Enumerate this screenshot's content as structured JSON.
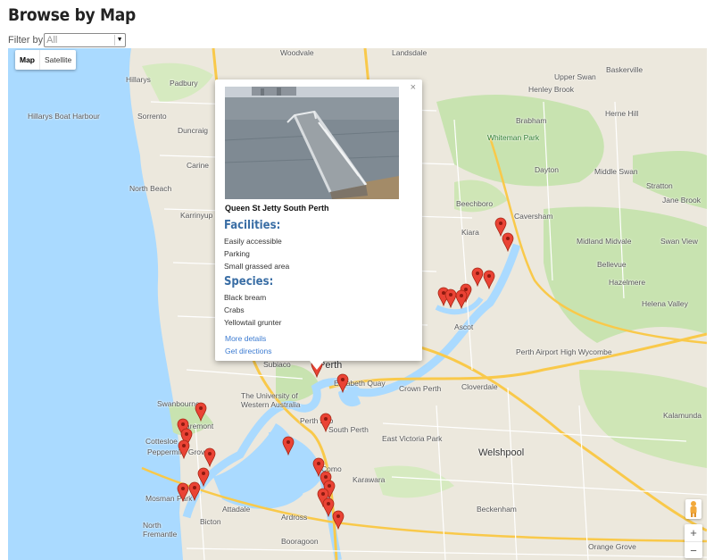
{
  "page": {
    "title": "Browse by Map"
  },
  "filter": {
    "label": "Filter by",
    "value": "All"
  },
  "map": {
    "type_controls": [
      "Map",
      "Satellite"
    ],
    "zoom_in": "+",
    "zoom_out": "−",
    "labels": {
      "hillarys": "Hillarys",
      "padbury": "Padbury",
      "woodvale": "Woodvale",
      "landsdale": "Landsdale",
      "baskerville": "Baskerville",
      "upper_swan": "Upper Swan",
      "henley_brook": "Henley Brook",
      "hillarys_harbour": "Hillarys Boat Harbour",
      "sorrento": "Sorrento",
      "brabham": "Brabham",
      "herne_hill": "Herne Hill",
      "duncraig": "Duncraig",
      "whiteman_park": "Whiteman Park",
      "carine": "Carine",
      "dayton": "Dayton",
      "middle_swan": "Middle Swan",
      "north_beach": "North Beach",
      "stratton": "Stratton",
      "jane_brook": "Jane Brook",
      "karrinyup": "Karrinyup",
      "beechboro": "Beechboro",
      "caversham": "Caversham",
      "midland": "Midland Midvale",
      "swan_view": "Swan View",
      "kiara": "Kiara",
      "bellevue": "Bellevue",
      "hazelmere": "Hazelmere",
      "helena_valley": "Helena Valley",
      "ascot": "Ascot",
      "perth_airport": "Perth Airport",
      "high_wycombe": "High Wycombe",
      "perth": "Perth",
      "elizabeth_quay": "Elizabeth Quay",
      "crown_perth": "Crown Perth",
      "subiaco": "Subiaco",
      "cloverdale": "Cloverdale",
      "swanbourne": "Swanbourne",
      "uwa": "The University of Western Australia",
      "perth_zoo": "Perth Zoo",
      "claremont": "Claremont",
      "south_perth": "South Perth",
      "east_victoria_park": "East Victoria Park",
      "kalamunda": "Kalamunda",
      "cottesloe": "Cottesloe",
      "peppermint_grove": "Peppermint Grove",
      "welshpool": "Welshpool",
      "como": "Como",
      "karawara": "Karawara",
      "mosman_park": "Mosman Park",
      "attadale": "Attadale",
      "ardross": "Ardross",
      "beckenham": "Beckenham",
      "bicton": "Bicton",
      "north_fremantle": "North Fremantle",
      "booragoon": "Booragoon",
      "orange_grove": "Orange Grove"
    }
  },
  "popup": {
    "close": "×",
    "place_name": "Queen St Jetty South Perth",
    "facilities_heading": "Facilities:",
    "facilities": [
      "Easily accessible",
      "Parking",
      "Small grassed area"
    ],
    "species_heading": "Species:",
    "species": [
      "Black bream",
      "Crabs",
      "Yellowtail grunter"
    ],
    "more_details": "More details",
    "get_directions": "Get directions"
  },
  "colors": {
    "ocean": "#aadaff",
    "land": "#ece8dd",
    "park": "#c8e3b0",
    "marker": "#ea4335",
    "link": "#3c7bd1",
    "heading": "#3a6ea5"
  }
}
